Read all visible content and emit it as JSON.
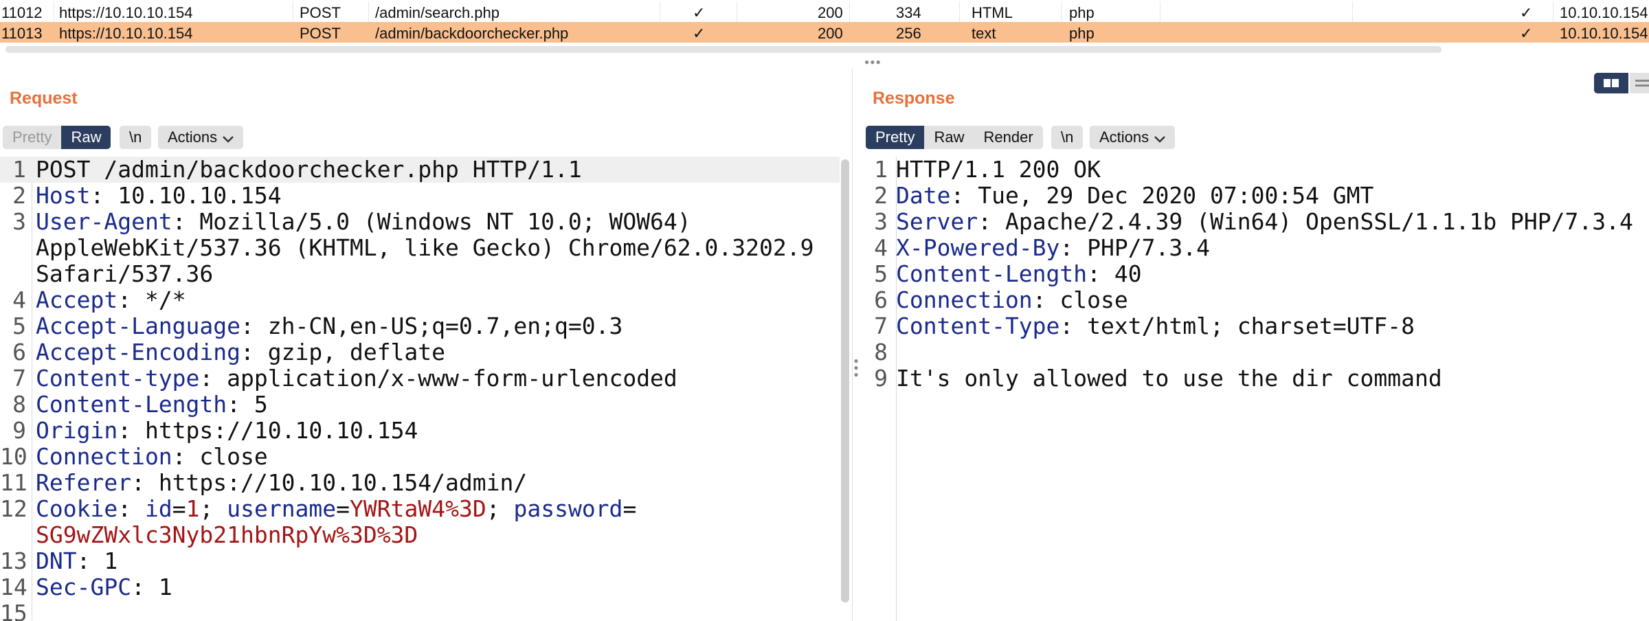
{
  "history": {
    "rows": [
      {
        "num": "11012",
        "host": "https://10.10.10.154",
        "method": "POST",
        "url": "/admin/search.php",
        "params": "✓",
        "status": "200",
        "length": "334",
        "mime": "HTML",
        "ext": "php",
        "tls": "✓",
        "ip": "10.10.10.154",
        "selected": false
      },
      {
        "num": "11013",
        "host": "https://10.10.10.154",
        "method": "POST",
        "url": "/admin/backdoorchecker.php",
        "params": "✓",
        "status": "200",
        "length": "256",
        "mime": "text",
        "ext": "php",
        "tls": "✓",
        "ip": "10.10.10.154",
        "selected": true
      }
    ],
    "selected_color": "#f9bf8f"
  },
  "request": {
    "title": "Request",
    "tabs": [
      {
        "label": "Pretty",
        "state": "disabled"
      },
      {
        "label": "Raw",
        "state": "active"
      }
    ],
    "newline_label": "\\n",
    "actions_label": "Actions",
    "lines": [
      {
        "n": "1",
        "parts": [
          {
            "t": "POST /admin/backdoorchecker.php HTTP/1.1",
            "c": "v"
          }
        ]
      },
      {
        "n": "2",
        "parts": [
          {
            "t": "Host",
            "c": "k"
          },
          {
            "t": ": 10.10.10.154",
            "c": "v"
          }
        ]
      },
      {
        "n": "3",
        "parts": [
          {
            "t": "User-Agent",
            "c": "k"
          },
          {
            "t": ": Mozilla/5.0 (Windows NT 10.0; WOW64)",
            "c": "v"
          }
        ]
      },
      {
        "n": "",
        "cont": true,
        "parts": [
          {
            "t": "AppleWebKit/537.36 (KHTML, like Gecko) Chrome/62.0.3202.9",
            "c": "v"
          }
        ]
      },
      {
        "n": "",
        "cont": true,
        "parts": [
          {
            "t": "Safari/537.36",
            "c": "v"
          }
        ]
      },
      {
        "n": "4",
        "parts": [
          {
            "t": "Accept",
            "c": "k"
          },
          {
            "t": ": */*",
            "c": "v"
          }
        ]
      },
      {
        "n": "5",
        "parts": [
          {
            "t": "Accept-Language",
            "c": "k"
          },
          {
            "t": ": zh-CN,en-US;q=0.7,en;q=0.3",
            "c": "v"
          }
        ]
      },
      {
        "n": "6",
        "parts": [
          {
            "t": "Accept-Encoding",
            "c": "k"
          },
          {
            "t": ": gzip, deflate",
            "c": "v"
          }
        ]
      },
      {
        "n": "7",
        "parts": [
          {
            "t": "Content-type",
            "c": "k"
          },
          {
            "t": ": application/x-www-form-urlencoded",
            "c": "v"
          }
        ]
      },
      {
        "n": "8",
        "parts": [
          {
            "t": "Content-Length",
            "c": "k"
          },
          {
            "t": ": 5",
            "c": "v"
          }
        ]
      },
      {
        "n": "9",
        "parts": [
          {
            "t": "Origin",
            "c": "k"
          },
          {
            "t": ": https://10.10.10.154",
            "c": "v"
          }
        ]
      },
      {
        "n": "10",
        "parts": [
          {
            "t": "Connection",
            "c": "k"
          },
          {
            "t": ": close",
            "c": "v"
          }
        ]
      },
      {
        "n": "11",
        "parts": [
          {
            "t": "Referer",
            "c": "k"
          },
          {
            "t": ": https://10.10.10.154/admin/",
            "c": "v"
          }
        ]
      },
      {
        "n": "12",
        "parts": [
          {
            "t": "Cookie",
            "c": "k"
          },
          {
            "t": ": ",
            "c": "v"
          },
          {
            "t": "id",
            "c": "k"
          },
          {
            "t": "=",
            "c": "v"
          },
          {
            "t": "1",
            "c": "rv"
          },
          {
            "t": "; ",
            "c": "v"
          },
          {
            "t": "username",
            "c": "k"
          },
          {
            "t": "=",
            "c": "v"
          },
          {
            "t": "YWRtaW4%3D",
            "c": "rv"
          },
          {
            "t": "; ",
            "c": "v"
          },
          {
            "t": "password",
            "c": "k"
          },
          {
            "t": "=",
            "c": "v"
          }
        ]
      },
      {
        "n": "",
        "cont": true,
        "parts": [
          {
            "t": "SG9wZWxlc3Nyb21hbnRpYw%3D%3D",
            "c": "rv"
          }
        ]
      },
      {
        "n": "13",
        "parts": [
          {
            "t": "DNT",
            "c": "k"
          },
          {
            "t": ": 1",
            "c": "v"
          }
        ]
      },
      {
        "n": "14",
        "parts": [
          {
            "t": "Sec-GPC",
            "c": "k"
          },
          {
            "t": ": 1",
            "c": "v"
          }
        ]
      },
      {
        "n": "15",
        "parts": [
          {
            "t": "",
            "c": "v"
          }
        ]
      }
    ]
  },
  "response": {
    "title": "Response",
    "tabs": [
      {
        "label": "Pretty",
        "state": "active"
      },
      {
        "label": "Raw",
        "state": "normal"
      },
      {
        "label": "Render",
        "state": "normal"
      }
    ],
    "newline_label": "\\n",
    "actions_label": "Actions",
    "lines": [
      {
        "n": "1",
        "parts": [
          {
            "t": "HTTP/1.1 200 OK",
            "c": "v"
          }
        ]
      },
      {
        "n": "2",
        "parts": [
          {
            "t": "Date",
            "c": "k"
          },
          {
            "t": ": Tue, 29 Dec 2020 07:00:54 GMT",
            "c": "v"
          }
        ]
      },
      {
        "n": "3",
        "parts": [
          {
            "t": "Server",
            "c": "k"
          },
          {
            "t": ": Apache/2.4.39 (Win64) OpenSSL/1.1.1b PHP/7.3.4",
            "c": "v"
          }
        ]
      },
      {
        "n": "4",
        "parts": [
          {
            "t": "X-Powered-By",
            "c": "k"
          },
          {
            "t": ": PHP/7.3.4",
            "c": "v"
          }
        ]
      },
      {
        "n": "5",
        "parts": [
          {
            "t": "Content-Length",
            "c": "k"
          },
          {
            "t": ": 40",
            "c": "v"
          }
        ]
      },
      {
        "n": "6",
        "parts": [
          {
            "t": "Connection",
            "c": "k"
          },
          {
            "t": ": close",
            "c": "v"
          }
        ]
      },
      {
        "n": "7",
        "parts": [
          {
            "t": "Content-Type",
            "c": "k"
          },
          {
            "t": ": text/html; charset=UTF-8",
            "c": "v"
          }
        ]
      },
      {
        "n": "8",
        "parts": [
          {
            "t": "",
            "c": "v"
          }
        ]
      },
      {
        "n": "9",
        "parts": [
          {
            "t": "It's only allowed to use the dir command",
            "c": "v"
          }
        ]
      }
    ]
  },
  "colors": {
    "accent": "#e8703a",
    "active_tab": "#2c3e5f",
    "header_key": "#1a2a8c",
    "cookie_value": "#a31515"
  }
}
